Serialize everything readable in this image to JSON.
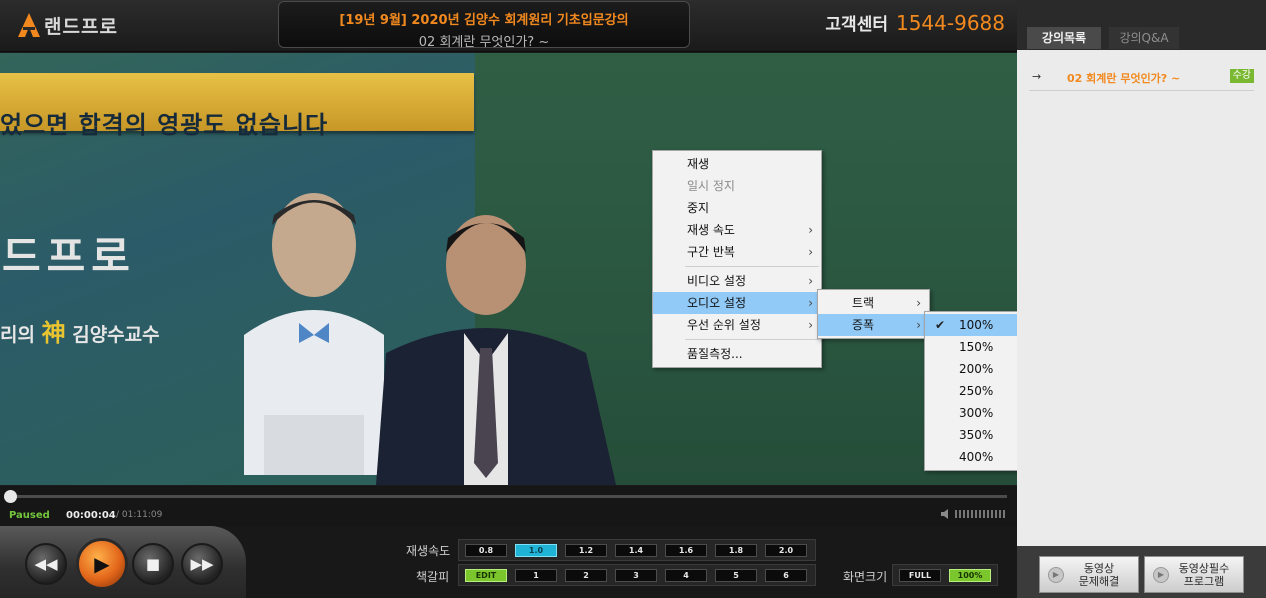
{
  "header": {
    "logo_text": "랜드프로",
    "title": "[19년 9월] 2020년 김양수 회계원리 기초입문강의",
    "subtitle": "02 회계란 무엇인가? ~",
    "cs_label": "고객센터",
    "cs_phone": "1544-9688"
  },
  "video": {
    "banner_text": "었으면 합격의 영광도 없습니다",
    "brand_text": "드프로",
    "prof_prefix": "리의",
    "prof_god": "神",
    "prof_name": "김양수교수"
  },
  "context_menu": {
    "items": [
      {
        "label": "재생",
        "enabled": true,
        "submenu": false
      },
      {
        "label": "일시 정지",
        "enabled": false,
        "submenu": false
      },
      {
        "label": "중지",
        "enabled": true,
        "submenu": false
      },
      {
        "label": "재생 속도",
        "enabled": true,
        "submenu": true
      },
      {
        "label": "구간 반복",
        "enabled": true,
        "submenu": true
      },
      {
        "label": "비디오 설정",
        "enabled": true,
        "submenu": true
      },
      {
        "label": "오디오 설정",
        "enabled": true,
        "submenu": true,
        "highlighted": true
      },
      {
        "label": "우선 순위 설정",
        "enabled": true,
        "submenu": true
      },
      {
        "label": "품질측정...",
        "enabled": true,
        "submenu": false
      }
    ],
    "audio_submenu": [
      {
        "label": "트랙"
      },
      {
        "label": "증폭",
        "highlighted": true
      }
    ],
    "amplify_submenu": {
      "options": [
        "100%",
        "150%",
        "200%",
        "250%",
        "300%",
        "350%",
        "400%"
      ],
      "selected": "100%"
    }
  },
  "player": {
    "status": "Paused",
    "time_current": "00:00:04",
    "time_total": "/ 01:11:09",
    "progress": 0.001,
    "speed_label": "재생속도",
    "speeds": [
      "0.8",
      "1.0",
      "1.2",
      "1.4",
      "1.6",
      "1.8",
      "2.0"
    ],
    "speed_selected": "1.0",
    "bookmark_label": "책갈피",
    "bookmarks": [
      "EDIT",
      "1",
      "2",
      "3",
      "4",
      "5",
      "6"
    ],
    "screen_label": "화면크기",
    "screen_sizes": [
      "FULL",
      "100%"
    ],
    "screen_selected": "100%"
  },
  "sidebar": {
    "tabs": [
      "강의목록",
      "강의Q&A"
    ],
    "active_tab": "강의목록",
    "lecture": {
      "arrow": "→",
      "title": "02 회계란 무엇인가? ~",
      "badge": "수강"
    },
    "buttons": [
      "동영상\n문제해결",
      "동영상필수\n프로그램"
    ]
  },
  "colors": {
    "accent": "#f2891f",
    "status_green": "#73c63c",
    "speed_selected": "#1fb3d6",
    "edit_green": "#7cc62d",
    "menu_highlight": "#91c9f7"
  }
}
